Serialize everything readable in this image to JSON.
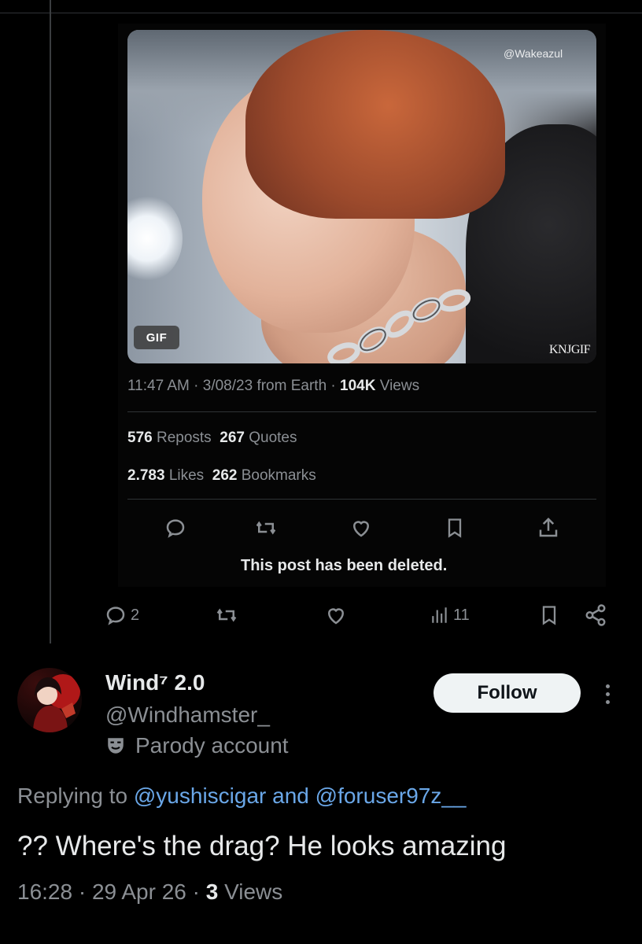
{
  "quoted_post": {
    "media": {
      "badge": "GIF",
      "watermark": "@Wakeazul",
      "corner_mark": "KNJGIF"
    },
    "time": "11:47 AM",
    "date": "3/08/23",
    "source": "from Earth",
    "views_count": "104K",
    "views_label": "Views",
    "reposts_count": "576",
    "reposts_label": "Reposts",
    "quotes_count": "267",
    "quotes_label": "Quotes",
    "likes_count": "2.783",
    "likes_label": "Likes",
    "bookmarks_count": "262",
    "bookmarks_label": "Bookmarks",
    "deleted_notice": "This post has been deleted."
  },
  "parent_actions": {
    "reply_count": "2",
    "analytics_count": "11"
  },
  "reply": {
    "display_name": "Wind⁷ 2.0",
    "handle": "@Windhamster_",
    "account_label": "Parody account",
    "follow_label": "Follow",
    "replying_prefix": "Replying to",
    "mention_1": "@yushiscigar",
    "mention_joiner": "and",
    "mention_2": "@foruser97z__",
    "text": "?? Where's the drag? He looks amazing",
    "time": "16:28",
    "date": "29 Apr 26",
    "views_count": "3",
    "views_label": "Views"
  },
  "icons": {
    "reply": "reply-icon",
    "repost": "repost-icon",
    "like": "heart-icon",
    "bookmark": "bookmark-icon",
    "share": "share-icon",
    "analytics": "analytics-icon",
    "parody": "theater-mask-icon",
    "more": "more-icon"
  },
  "colors": {
    "background": "#000000",
    "text": "#e7e9ea",
    "muted": "#8b8f94",
    "link": "#6aa7e8",
    "follow_button": "#eff3f4"
  }
}
